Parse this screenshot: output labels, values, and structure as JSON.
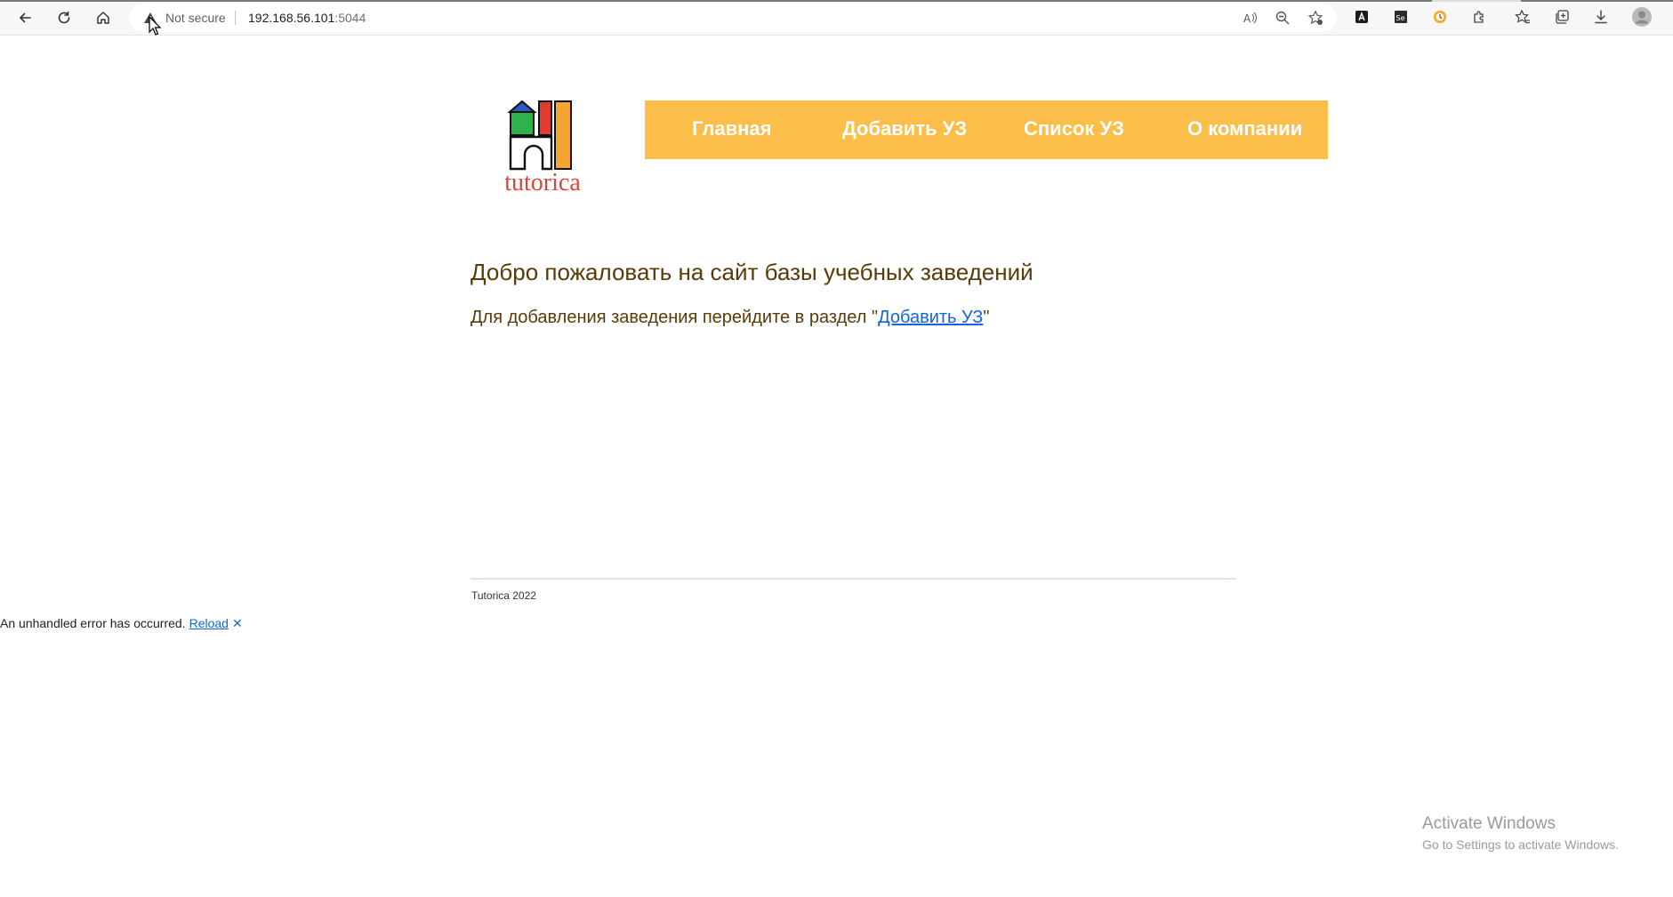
{
  "browser": {
    "security_label": "Not secure",
    "url_host": "192.168.56.101",
    "url_port": ":5044",
    "icons": [
      "back-icon",
      "reload-icon",
      "home-icon",
      "warning-icon",
      "read-aloud-icon",
      "zoom-icon",
      "favorite-add-icon",
      "extension-a-icon",
      "extension-se-icon",
      "extension-clock-icon",
      "extensions-icon",
      "favorites-icon",
      "collections-icon",
      "downloads-icon",
      "profile-icon"
    ]
  },
  "site": {
    "logo_text": "tutorica",
    "nav": [
      {
        "label": "Главная"
      },
      {
        "label": "Добавить УЗ"
      },
      {
        "label": "Список УЗ"
      },
      {
        "label": "О компании"
      }
    ],
    "nav_bg_color": "#fbbe4a",
    "welcome_title": "Добро пожаловать на сайт базы учебных заведений",
    "lead_prefix": "Для добавления заведения перейдите в раздел \"",
    "lead_link": "Добавить УЗ",
    "lead_suffix": "\"",
    "footer": "Tutorica 2022"
  },
  "error_bar": {
    "message": "An unhandled error has occurred.",
    "reload_label": "Reload",
    "dismiss": "✕"
  },
  "watermark": {
    "title": "Activate Windows",
    "subtitle": "Go to Settings to activate Windows."
  }
}
